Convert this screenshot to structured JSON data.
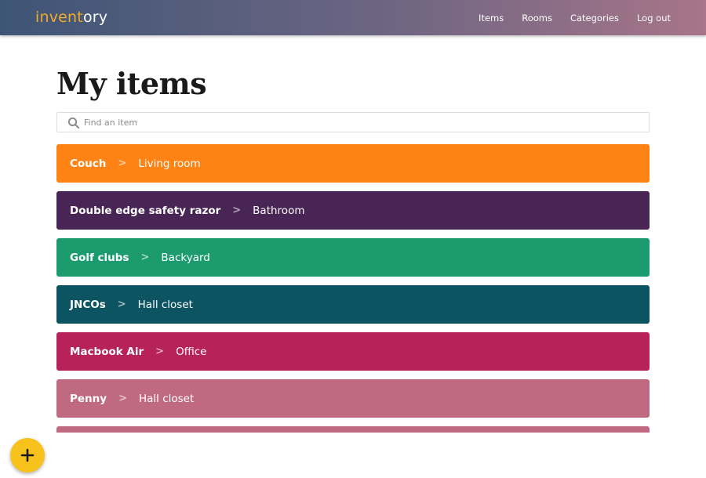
{
  "brand": {
    "part1": "invent",
    "part2": "ory"
  },
  "nav": [
    {
      "label": "Items"
    },
    {
      "label": "Rooms"
    },
    {
      "label": "Categories"
    },
    {
      "label": "Log out"
    }
  ],
  "page_title": "My items",
  "search": {
    "placeholder": "Find an item",
    "value": ""
  },
  "separator": ">",
  "items": [
    {
      "name": "Couch",
      "room": "Living room",
      "color": "#fe8315"
    },
    {
      "name": "Double edge safety razor",
      "room": "Bathroom",
      "color": "#482555"
    },
    {
      "name": "Golf clubs",
      "room": "Backyard",
      "color": "#1c9b6f"
    },
    {
      "name": "JNCOs",
      "room": "Hall closet",
      "color": "#0c5461"
    },
    {
      "name": "Macbook Air",
      "room": "Office",
      "color": "#b72358"
    },
    {
      "name": "Penny",
      "room": "Hall closet",
      "color": "#c06a82"
    },
    {
      "name": "",
      "room": "",
      "color": "#c06a82"
    }
  ],
  "colors": {
    "fab": "#f7c21b",
    "brand_accent": "#f3a92a"
  },
  "fab": {
    "icon": "plus-icon"
  }
}
